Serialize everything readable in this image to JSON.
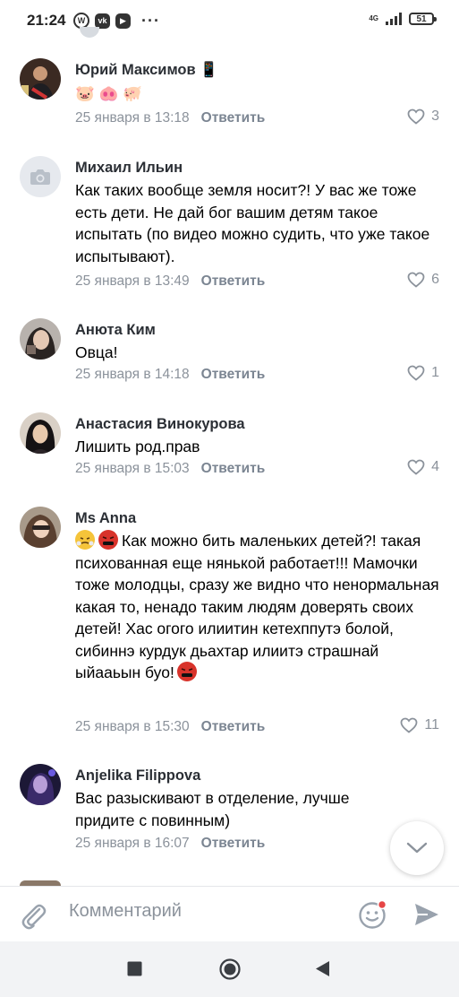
{
  "status_bar": {
    "time": "21:24",
    "apps": [
      {
        "icon": "whatsapp-icon",
        "glyph": "W"
      },
      {
        "icon": "vk-icon",
        "glyph": "vk"
      },
      {
        "icon": "youtube-icon",
        "glyph": "▶"
      }
    ],
    "more": "···",
    "network": "4G",
    "battery": "51"
  },
  "comments": [
    {
      "author": "Юрий Максимов 📱",
      "text": "🐷 🐽 🐖",
      "date": "25 января в 13:18",
      "reply": "Ответить",
      "likes": "3"
    },
    {
      "author": "Михаил Ильин",
      "text": "Как таких вообще земля носит?! У вас же тоже есть дети. Не дай бог вашим детям такое испытать (по видео можно судить, что уже такое испытывают).",
      "date": "25 января в 13:49",
      "reply": "Ответить",
      "likes": "6"
    },
    {
      "author": "Анюта Ким",
      "text": "Овца!",
      "date": "25 января в 14:18",
      "reply": "Ответить",
      "likes": "1"
    },
    {
      "author": "Анастасия Винокурова",
      "text": "Лишить род.прав",
      "date": "25 января в 15:03",
      "reply": "Ответить",
      "likes": "4"
    },
    {
      "author": "Ms Anna",
      "text": "Как можно бить маленьких детей?! такая психованная еще нянькой работает!!! Мамочки тоже молодцы, сразу же видно что ненормальная какая то, ненадо таким людям доверять своих детей! Хас огого илиитин кетехппутэ болой, сибиннэ курдук дьахтар илиитэ страшнай ыйааьын буо!",
      "date": "25 января в 15:30",
      "reply": "Ответить",
      "likes": "11"
    },
    {
      "author": "Anjelika Filippova",
      "text": "Вас разыскивают в отделение, лучше придите с повинным)",
      "date": "25 января в 16:07",
      "reply": "Ответить",
      "likes": ""
    }
  ],
  "composer": {
    "placeholder": "Комментарий"
  },
  "colors": {
    "meta_text": "#8b929b",
    "author_text": "#2b2f35",
    "accent_send": "#8b929b",
    "notification_dot": "#e64646"
  }
}
